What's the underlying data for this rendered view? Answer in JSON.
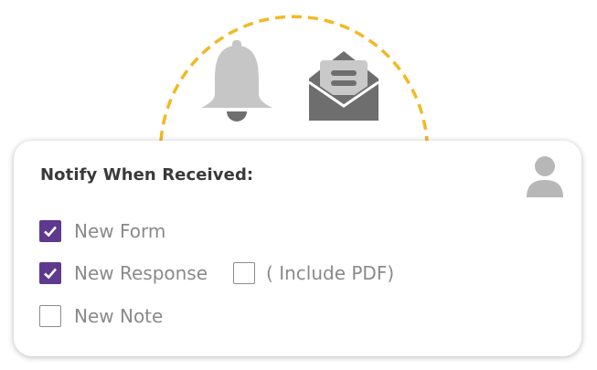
{
  "header_icons": {
    "bell_icon": "bell-icon",
    "envelope_icon": "open-envelope-icon",
    "arc_color": "#f1b923",
    "icon_color_light": "#c4c4c4",
    "icon_color_dark": "#6e6e6e"
  },
  "card": {
    "title": "Notify When Received:",
    "avatar_icon": "user-icon",
    "accent_color": "#5e3a8e",
    "options": [
      {
        "label": "New Form",
        "checked": true
      },
      {
        "label": "New Response",
        "checked": true
      },
      {
        "label": "New Note",
        "checked": false
      }
    ],
    "include_pdf": {
      "label": "( Include PDF)",
      "checked": false
    }
  }
}
